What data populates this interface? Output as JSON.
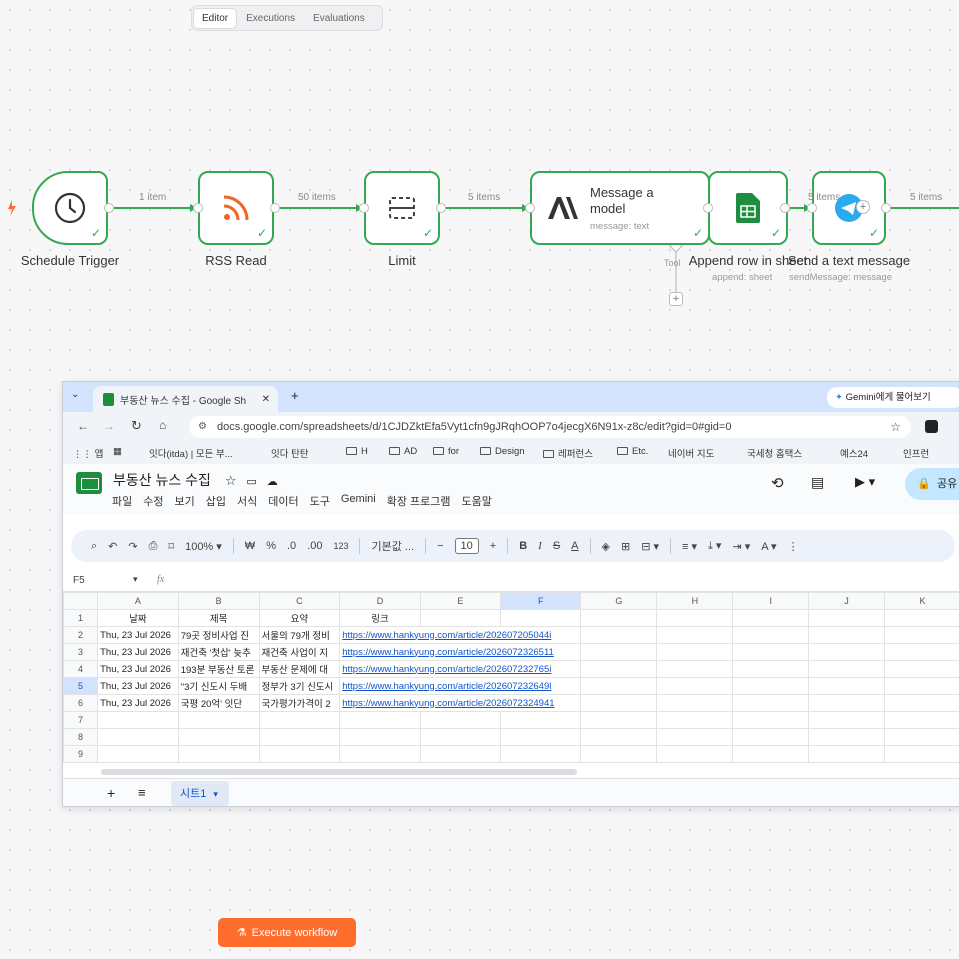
{
  "top_tabs": [
    "Editor",
    "Executions",
    "Evaluations"
  ],
  "workflow": {
    "nodes": {
      "schedule": {
        "title": "Schedule Trigger"
      },
      "rss": {
        "title": "RSS Read"
      },
      "limit": {
        "title": "Limit"
      },
      "model": {
        "title_line1": "Message a",
        "title_line2": "model",
        "sub": "message: text",
        "tool_label": "Tool"
      },
      "sheets": {
        "title": "Append row in sheet",
        "sub": "append: sheet"
      },
      "message": {
        "title": "Send a text message",
        "sub": "sendMessage: message"
      }
    },
    "edges": [
      "1 item",
      "50 items",
      "5 items",
      "5 items",
      "5 items"
    ]
  },
  "browser": {
    "tab_title": "부동산 뉴스 수집 - Google Sh",
    "gemini": "Gemini에게 물어보기",
    "url": "docs.google.com/spreadsheets/d/1CJDZktEfa5Vyt1cfn9gJRqhOOP7o4jecgX6N91x-z8c/edit?gid=0#gid=0",
    "bookmarks": [
      "앱",
      "잇다(itda) | 모든 부...",
      "잇다 탄탄",
      "H",
      "AD",
      "for",
      "Design",
      "레퍼런스",
      "Etc.",
      "네이버 지도",
      "국세청 홈택스",
      "예스24",
      "인프런"
    ]
  },
  "sheet": {
    "title": "부동산 뉴스 수집",
    "menu": [
      "파일",
      "수정",
      "보기",
      "삽입",
      "서식",
      "데이터",
      "도구",
      "Gemini",
      "확장 프로그램",
      "도움말"
    ],
    "share": "공유",
    "toolbar": {
      "zoom": "100%",
      "currency": "₩",
      "percent": "%",
      "dec_less": ".0",
      "dec_more": ".00",
      "num123": "123",
      "format": "기본값 ...",
      "font_size": "10"
    },
    "cell_ref": "F5",
    "fx": "fx",
    "columns": [
      "A",
      "B",
      "C",
      "D",
      "E",
      "F",
      "G",
      "H",
      "I",
      "J",
      "K"
    ],
    "rows": [
      [
        "날짜",
        "제목",
        "요약",
        "링크",
        "",
        "",
        "",
        "",
        "",
        "",
        ""
      ],
      [
        "Thu, 23 Jul 2026",
        "79곳 정비사업 진",
        "서울의 79개 정비",
        "https://www.hankyung.com/article/202607205044i",
        "",
        "",
        "",
        "",
        "",
        "",
        ""
      ],
      [
        "Thu, 23 Jul 2026",
        "재건축 '첫삽' 늦추",
        "재건축 사업이 지",
        "https://www.hankyung.com/article/2026072326511",
        "",
        "",
        "",
        "",
        "",
        "",
        ""
      ],
      [
        "Thu, 23 Jul 2026",
        "193분 부동산 토론",
        "부동산 문제에 대",
        "https://www.hankyung.com/article/202607232765i",
        "",
        "",
        "",
        "",
        "",
        "",
        ""
      ],
      [
        "Thu, 23 Jul 2026",
        "\"3기 신도시 두배",
        "정부가 3기 신도시",
        "https://www.hankyung.com/article/202607232649l",
        "",
        "",
        "",
        "",
        "",
        "",
        ""
      ],
      [
        "Thu, 23 Jul 2026",
        "국평 20억' 잇단",
        "국가평가가격이 2",
        "https://www.hankyung.com/article/2026072324941",
        "",
        "",
        "",
        "",
        "",
        "",
        ""
      ],
      [
        "",
        "",
        "",
        "",
        "",
        "",
        "",
        "",
        "",
        "",
        ""
      ],
      [
        "",
        "",
        "",
        "",
        "",
        "",
        "",
        "",
        "",
        "",
        ""
      ],
      [
        "",
        "",
        "",
        "",
        "",
        "",
        "",
        "",
        "",
        "",
        ""
      ]
    ],
    "row_numbers": [
      "1",
      "2",
      "3",
      "4",
      "5",
      "6",
      "7",
      "8",
      "9"
    ],
    "sheet_tab": "시트1"
  },
  "execute_button": "Execute workflow"
}
